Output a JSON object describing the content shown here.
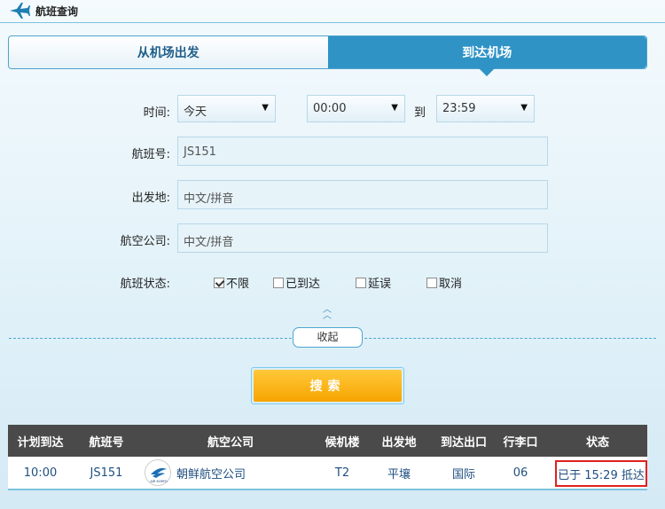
{
  "header": {
    "title": "航班查询"
  },
  "tabs": [
    {
      "label": "从机场出发",
      "active": false
    },
    {
      "label": "到达机场",
      "active": true
    }
  ],
  "form": {
    "time_label": "时间:",
    "date_value": "今天",
    "from_time": "00:00",
    "to_label": "到",
    "to_time": "23:59",
    "flight_no_label": "航班号:",
    "flight_no_value": "JS151",
    "origin_label": "出发地:",
    "origin_placeholder": "中文/拼音",
    "airline_label": "航空公司:",
    "airline_placeholder": "中文/拼音",
    "status_label": "航班状态:",
    "status_options": [
      {
        "label": "不限",
        "checked": true
      },
      {
        "label": "已到达",
        "checked": false
      },
      {
        "label": "延误",
        "checked": false
      },
      {
        "label": "取消",
        "checked": false
      }
    ],
    "collapse_label": "收起",
    "search_label": "搜索"
  },
  "table": {
    "headers": [
      "计划到达",
      "航班号",
      "航空公司",
      "候机楼",
      "出发地",
      "到达出口",
      "行李口",
      "状态"
    ],
    "rows": [
      {
        "scheduled": "10:00",
        "flight": "JS151",
        "airline": "朝鲜航空公司",
        "logo_text": "AIR KORYO",
        "terminal": "T2",
        "origin": "平壤",
        "exit": "国际",
        "baggage": "06",
        "status": "已于 15:29 抵达"
      }
    ]
  },
  "colors": {
    "accent": "#2f93c6",
    "search": "#f7a400",
    "highlight": "#e02020"
  }
}
